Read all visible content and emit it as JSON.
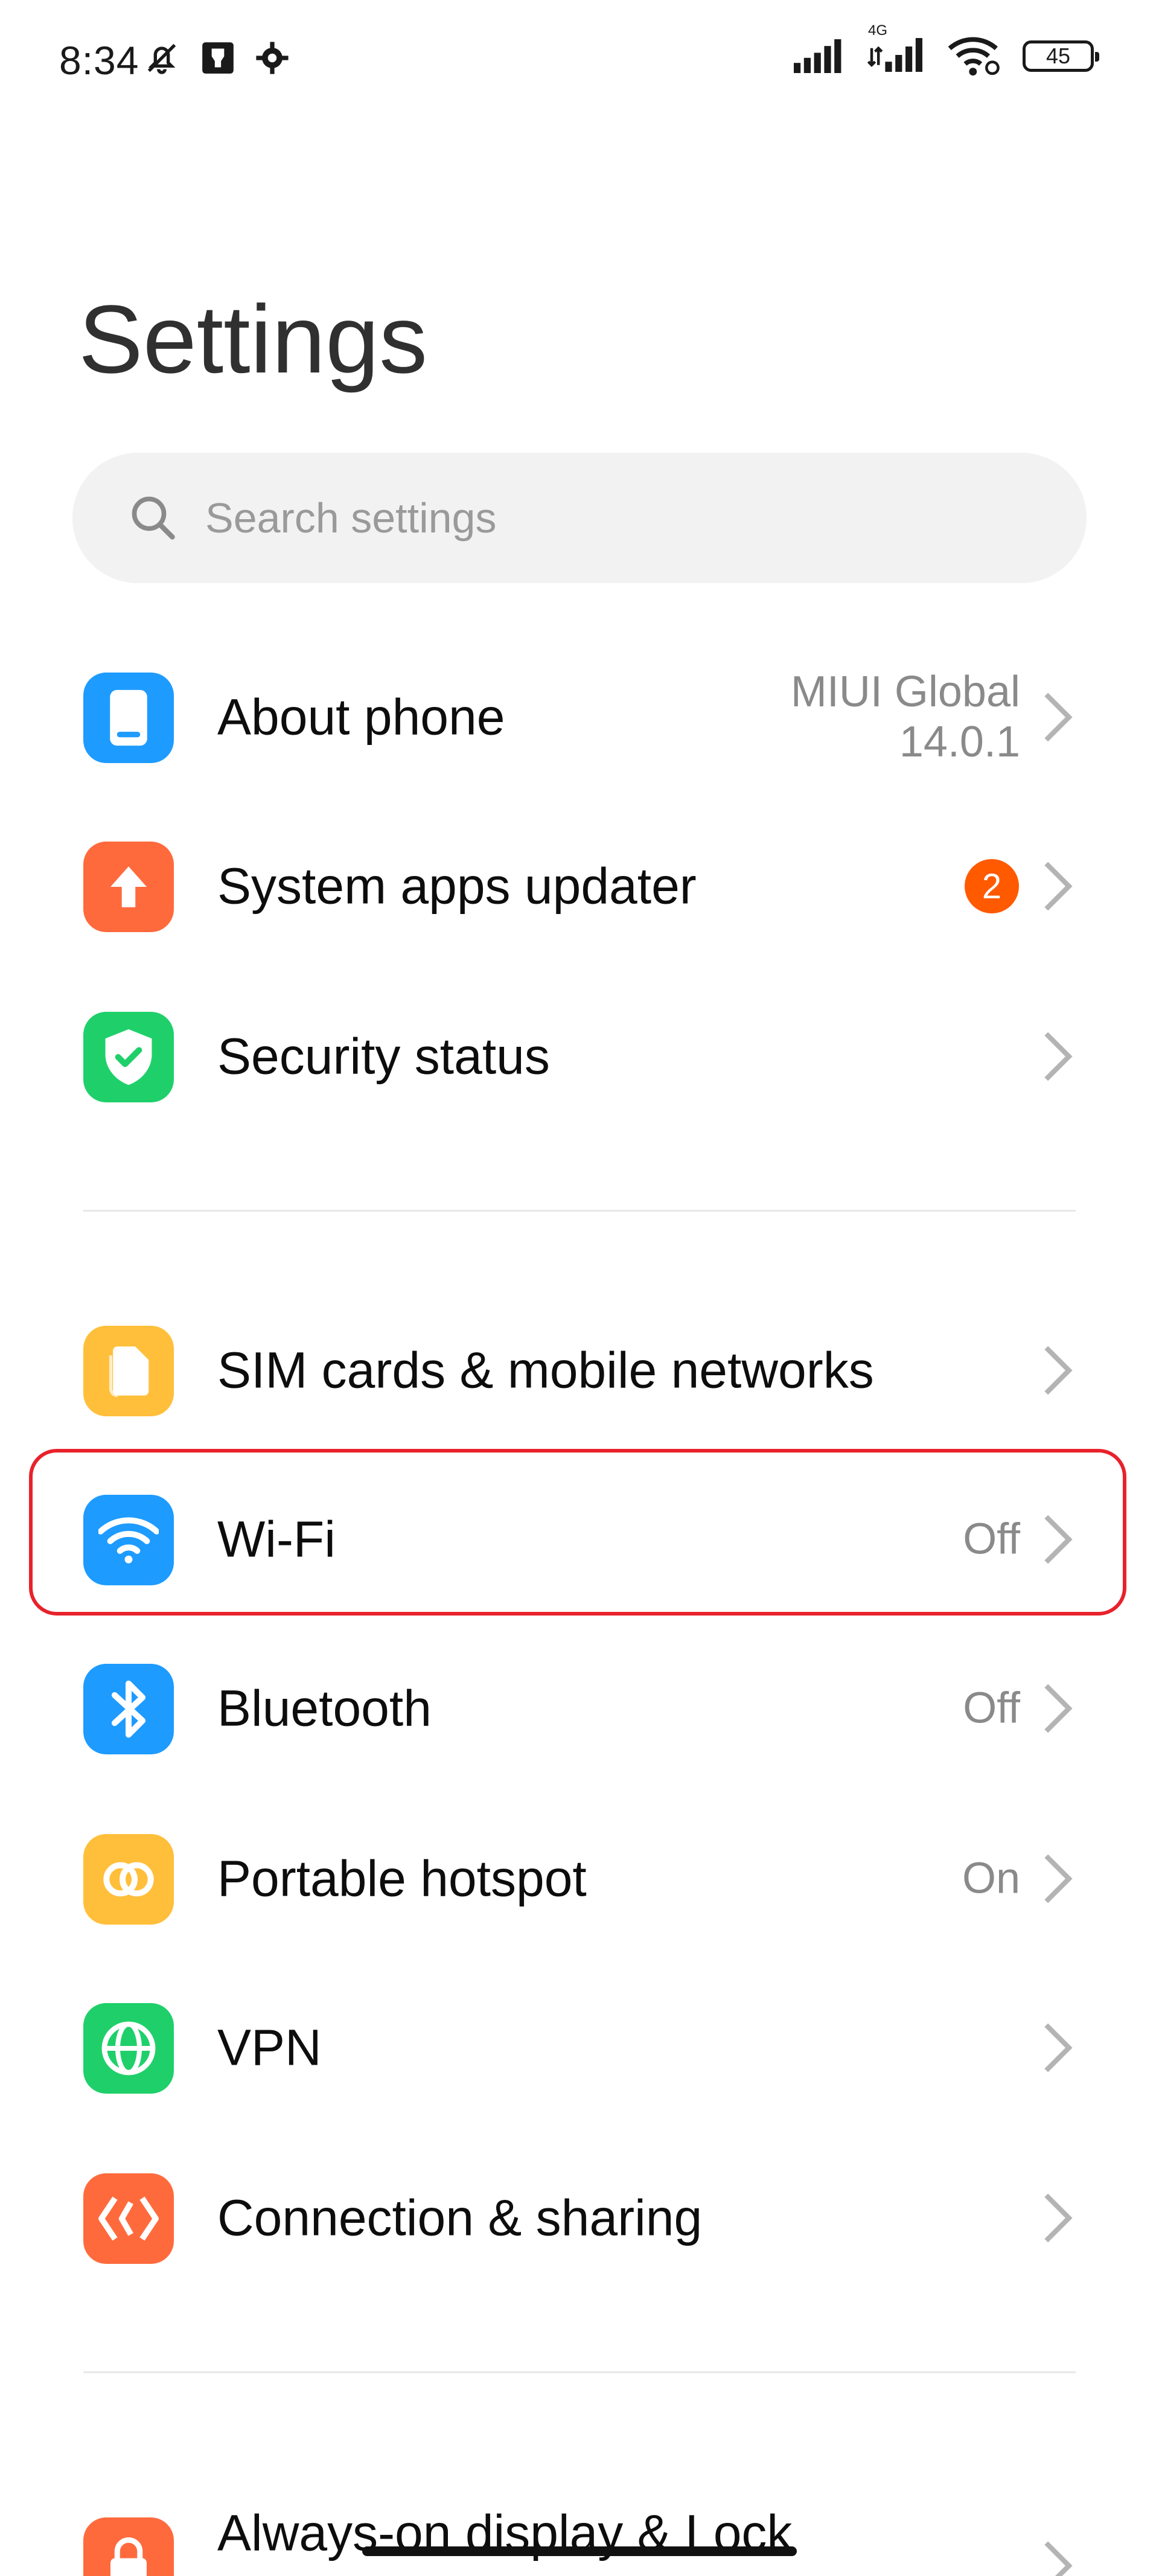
{
  "status_bar": {
    "time": "8:34",
    "network_type": "4G",
    "battery_level": "45"
  },
  "page": {
    "title": "Settings"
  },
  "search": {
    "placeholder": "Search settings"
  },
  "items": [
    {
      "label": "About phone",
      "value_line1": "MIUI Global",
      "value_line2": "14.0.1",
      "icon": "phone-icon",
      "color": "#1e9bff"
    },
    {
      "label": "System apps updater",
      "badge": "2",
      "icon": "arrow-up-icon",
      "color": "#ff6a3d"
    },
    {
      "label": "Security status",
      "icon": "shield-check-icon",
      "color": "#1fd06a"
    },
    {
      "label": "SIM cards & mobile networks",
      "icon": "sim-card-icon",
      "color": "#ffbf3a"
    },
    {
      "label": "Wi-Fi",
      "value": "Off",
      "icon": "wifi-icon",
      "color": "#1e9bff"
    },
    {
      "label": "Bluetooth",
      "value": "Off",
      "icon": "bluetooth-icon",
      "color": "#1e9bff"
    },
    {
      "label": "Portable hotspot",
      "value": "On",
      "icon": "hotspot-icon",
      "color": "#ffbf3a"
    },
    {
      "label": "VPN",
      "icon": "globe-icon",
      "color": "#1fd06a"
    },
    {
      "label": "Connection & sharing",
      "icon": "connection-sharing-icon",
      "color": "#ff6a3d"
    },
    {
      "label": "Always-on display & Lock",
      "icon": "lock-icon",
      "color": "#ff6a3d"
    }
  ],
  "colors": {
    "highlight": "#e8222b",
    "badge": "#ff5a00"
  }
}
